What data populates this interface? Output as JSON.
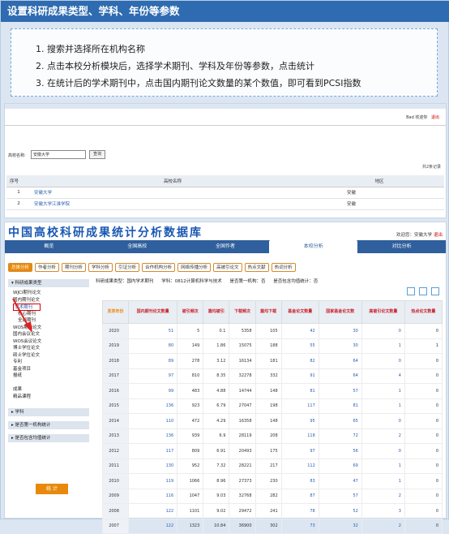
{
  "header": {
    "title": "设置科研成果类型、学科、年份等参数"
  },
  "instructions": [
    "1. 搜索并选择所在机构名称",
    "2. 点击本校分析模块后，选择学术期刊、学科及年份等参数，点击统计",
    "3. 在统计后的学术期刊中，点击国内期刊论文数量的某个数值，即可看到PCSI指数"
  ],
  "search_panel": {
    "user_links": [
      "Bad 欢迎你",
      "退出"
    ],
    "label": "高校名称:",
    "input_value": "安徽大学",
    "button": "查询",
    "count": "共2条记录",
    "columns": [
      "序号",
      "高校名称",
      "地区"
    ],
    "rows": [
      {
        "n": "1",
        "name": "安徽大学",
        "region": "安徽"
      },
      {
        "n": "2",
        "name": "安徽大学江淮学院",
        "region": "安徽"
      }
    ]
  },
  "stats_panel": {
    "title": "中国高校科研成果统计分析数据库",
    "welcome": "欢迎您：安徽大学",
    "logout": "退出",
    "nav": [
      "概览",
      "全国高校",
      "全国作者",
      "本校分析",
      "对比分析"
    ],
    "tabs": [
      "总体分析",
      "作者分析",
      "期刊分析",
      "学科分析",
      "引证分析",
      "合作机构分析",
      "网络传播分析",
      "高被引论文",
      "热点文献",
      "热词分析"
    ],
    "sidebar_head": "科研成果类型",
    "sidebar_items": [
      "WJCI期刊论文",
      "国内期刊论文",
      "学术期刊",
      "核心期刊",
      "全部期刊",
      "WOS期刊论文",
      "国内会议论文",
      "WOS会议论文",
      "博士学位论文",
      "硕士学位论文",
      "专利",
      "基金项目",
      "报纸",
      "",
      "成果",
      "精品课程"
    ],
    "sidebar_groups": [
      "学科",
      "是否第一机构统计",
      "是否包含均值统计"
    ],
    "stat_button": "统 计",
    "filters": [
      "科研成果类型：国内学术期刊",
      "学科：0812计算机科学与技术",
      "是否第一机构：否",
      "是否包含均值统计：否"
    ],
    "table_headers": [
      "发表年份",
      "国内期刊论文数量",
      "被引频次",
      "篇均被引",
      "下载频次",
      "篇均下载",
      "基金论文数量",
      "国家基金论文数",
      "高被引论文数量",
      "热点论文数量"
    ],
    "table_rows": [
      [
        "2020",
        "51",
        "5",
        "0.1",
        "5358",
        "105",
        "42",
        "30",
        "0",
        "0"
      ],
      [
        "2019",
        "80",
        "149",
        "1.86",
        "15075",
        "188",
        "55",
        "30",
        "1",
        "1"
      ],
      [
        "2018",
        "89",
        "278",
        "3.12",
        "16134",
        "181",
        "82",
        "64",
        "0",
        "0"
      ],
      [
        "2017",
        "97",
        "810",
        "8.35",
        "32278",
        "332",
        "91",
        "64",
        "4",
        "0"
      ],
      [
        "2016",
        "99",
        "483",
        "4.88",
        "14744",
        "148",
        "81",
        "57",
        "1",
        "0"
      ],
      [
        "2015",
        "136",
        "923",
        "6.79",
        "27047",
        "198",
        "117",
        "81",
        "1",
        "0"
      ],
      [
        "2014",
        "110",
        "472",
        "4.29",
        "16358",
        "148",
        "95",
        "65",
        "0",
        "0"
      ],
      [
        "2013",
        "136",
        "939",
        "6.9",
        "28119",
        "208",
        "118",
        "72",
        "2",
        "0"
      ],
      [
        "2012",
        "117",
        "809",
        "6.91",
        "20493",
        "175",
        "97",
        "56",
        "0",
        "0"
      ],
      [
        "2011",
        "130",
        "952",
        "7.32",
        "28221",
        "217",
        "112",
        "69",
        "1",
        "0"
      ],
      [
        "2010",
        "119",
        "1066",
        "8.96",
        "27373",
        "230",
        "83",
        "47",
        "1",
        "0"
      ],
      [
        "2009",
        "116",
        "1047",
        "9.03",
        "32768",
        "282",
        "87",
        "57",
        "2",
        "0"
      ],
      [
        "2008",
        "122",
        "1101",
        "9.02",
        "29472",
        "241",
        "78",
        "52",
        "3",
        "0"
      ],
      [
        "2007",
        "122",
        "1323",
        "10.84",
        "36900",
        "302",
        "73",
        "32",
        "2",
        "0"
      ]
    ]
  }
}
